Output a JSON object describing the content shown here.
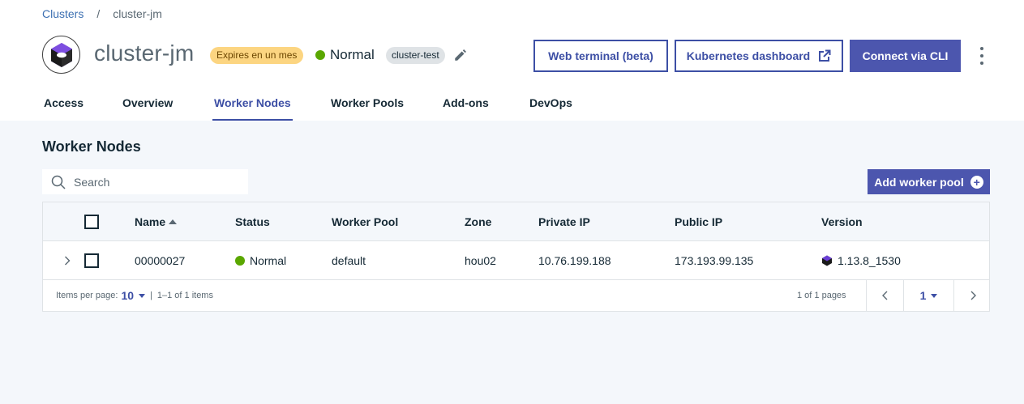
{
  "breadcrumb": {
    "parent": "Clusters",
    "separator": "/",
    "current": "cluster-jm"
  },
  "header": {
    "title": "cluster-jm",
    "expires_badge": "Expires en un mes",
    "status": "Normal",
    "tag": "cluster-test",
    "web_terminal_label": "Web terminal (beta)",
    "kube_dashboard_label": "Kubernetes dashboard",
    "connect_cli_label": "Connect via CLI",
    "icons": {
      "edit": "pencil-icon",
      "external": "launch-icon",
      "menu": "overflow-menu-icon",
      "logo": "cluster-logo-icon"
    }
  },
  "tabs": [
    {
      "label": "Access",
      "active": false
    },
    {
      "label": "Overview",
      "active": false
    },
    {
      "label": "Worker Nodes",
      "active": true
    },
    {
      "label": "Worker Pools",
      "active": false
    },
    {
      "label": "Add-ons",
      "active": false
    },
    {
      "label": "DevOps",
      "active": false
    }
  ],
  "main": {
    "section_title": "Worker Nodes",
    "search_placeholder": "Search",
    "add_pool_label": "Add worker pool"
  },
  "table": {
    "columns": [
      "Name",
      "Status",
      "Worker Pool",
      "Zone",
      "Private IP",
      "Public IP",
      "Version"
    ],
    "rows": [
      {
        "name": "00000027",
        "status": "Normal",
        "pool": "default",
        "zone": "hou02",
        "private_ip": "10.76.199.188",
        "public_ip": "173.193.99.135",
        "version": "1.13.8_1530"
      }
    ]
  },
  "pagination": {
    "items_per_page_label": "Items per page:",
    "per_page": "10",
    "divider": "|",
    "range": "1–1 of 1 items",
    "pages_text": "1 of 1 pages",
    "current_page": "1"
  },
  "colors": {
    "accent": "#3d4fa5",
    "status_ok": "#5aa700",
    "expires": "#fcd581",
    "content_bg": "#f4f7fb"
  }
}
